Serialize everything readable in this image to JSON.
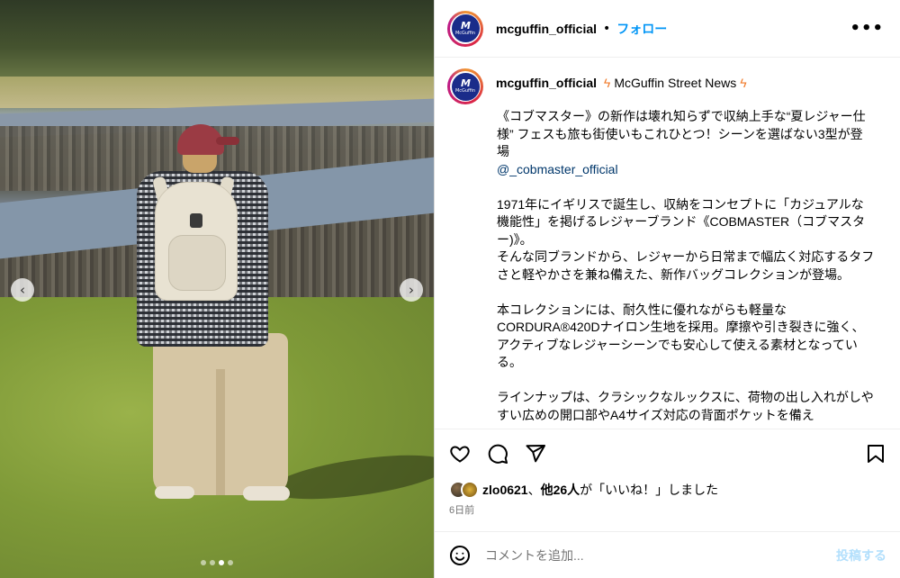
{
  "account": {
    "username": "mcguffin_official",
    "follow_label": "フォロー",
    "more_icon": "more-horizontal-icon",
    "avatar_logo": "M",
    "avatar_logo_sub": "McGuffin"
  },
  "caption": {
    "username": "mcguffin_official",
    "title": "McGuffin Street News",
    "paragraphs": [
      "《コブマスター》の新作は壊れ知らずで収納上手な“夏レジャー仕様” フェスも旅も街使いもこれひとつ！シーンを選ばない3型が登場",
      "1971年にイギリスで誕生し、収納をコンセプトに「カジュアルな機能性」を掲げるレジャーブランド《COBMASTER（コブマスター)》。\nそんな同ブランドから、レジャーから日常まで幅広く対応するタフさと軽やかさを兼ね備えた、新作バッグコレクションが登場。",
      "本コレクションには、耐久性に優れながらも軽量なCORDURA®420Dナイロン生地を採用。摩擦や引き裂きに強く、アクティブなレジャーシーンでも安心して使える素材となっている。",
      "ラインナップは、クラシックなルックスに、荷物の出し入れがしやすい広めの開口部やA4サイズ対応の背面ポケットを備え"
    ],
    "mention": "@_cobmaster_official"
  },
  "likes": {
    "user": "zlo0621",
    "others": "他26人",
    "suffix": "が「いいね！」しました",
    "separator": "、"
  },
  "post_date": "6日前",
  "comment": {
    "placeholder": "コメントを追加...",
    "post_label": "投稿する"
  },
  "carousel": {
    "total": 4,
    "active_index": 2
  },
  "colors": {
    "link_blue": "#0095f6",
    "mention": "#00376b",
    "muted": "#737373",
    "post_disabled": "#b2dffc"
  }
}
